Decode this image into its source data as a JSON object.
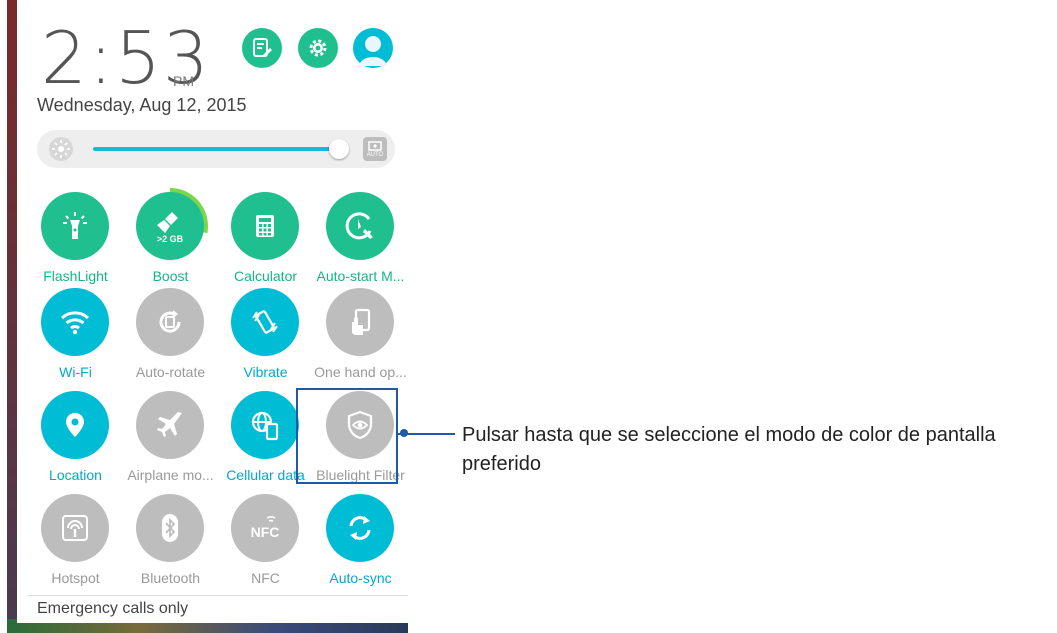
{
  "status": {
    "time": "2:53",
    "ampm": "PM",
    "date": "Wednesday, Aug 12, 2015"
  },
  "header_icons": [
    "notes-icon",
    "gear-icon",
    "avatar-icon"
  ],
  "brightness": {
    "level": 0.94,
    "auto_label": "AUTO"
  },
  "tiles": [
    {
      "label": "FlashLight",
      "icon": "flashlight-icon",
      "state": "on",
      "color": "#1fbf8f"
    },
    {
      "label": "Boost",
      "icon": "broom-icon",
      "state": "on",
      "color": "#1fbf8f",
      "badge": ">2 GB"
    },
    {
      "label": "Calculator",
      "icon": "calculator-icon",
      "state": "on",
      "color": "#1fbf8f"
    },
    {
      "label": "Auto-start M...",
      "icon": "auto-start-icon",
      "state": "on",
      "color": "#1fbf8f"
    },
    {
      "label": "Wi-Fi",
      "icon": "wifi-icon",
      "state": "on",
      "color": "#00bcd4"
    },
    {
      "label": "Auto-rotate",
      "icon": "rotate-icon",
      "state": "off",
      "color": "#bdbdbd"
    },
    {
      "label": "Vibrate",
      "icon": "vibrate-icon",
      "state": "on",
      "color": "#00bcd4"
    },
    {
      "label": "One hand op...",
      "icon": "one-hand-icon",
      "state": "off",
      "color": "#bdbdbd"
    },
    {
      "label": "Location",
      "icon": "location-pin-icon",
      "state": "on",
      "color": "#00bcd4"
    },
    {
      "label": "Airplane mo...",
      "icon": "airplane-icon",
      "state": "off",
      "color": "#bdbdbd"
    },
    {
      "label": "Cellular data",
      "icon": "cellular-data-icon",
      "state": "on",
      "color": "#00bcd4"
    },
    {
      "label": "Bluelight Filter",
      "icon": "eye-shield-icon",
      "state": "off",
      "color": "#bdbdbd"
    },
    {
      "label": "Hotspot",
      "icon": "hotspot-icon",
      "state": "off",
      "color": "#bdbdbd"
    },
    {
      "label": "Bluetooth",
      "icon": "bluetooth-icon",
      "state": "off",
      "color": "#bdbdbd"
    },
    {
      "label": "NFC",
      "icon": "nfc-icon",
      "state": "off",
      "color": "#bdbdbd"
    },
    {
      "label": "Auto-sync",
      "icon": "sync-icon",
      "state": "on",
      "color": "#00bcd4"
    }
  ],
  "footer": {
    "emergency": "Emergency calls only"
  },
  "callout": {
    "text": "Pulsar hasta que se seleccione el modo de color de pantalla preferido",
    "color": "#1e5aa8"
  }
}
